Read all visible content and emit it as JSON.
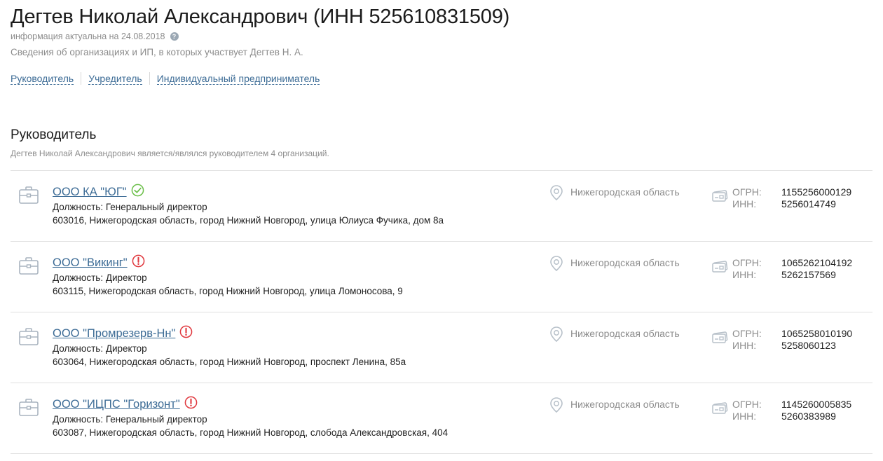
{
  "header": {
    "title": "Дегтев Николай Александрович (ИНН 525610831509)",
    "info_date": "информация актуальна на 24.08.2018",
    "help_glyph": "?",
    "subtitle": "Сведения об организациях и ИП, в которых участвует Дегтев Н. А."
  },
  "role_links": [
    {
      "label": "Руководитель"
    },
    {
      "label": "Учредитель"
    },
    {
      "label": "Индивидуальный предприниматель"
    }
  ],
  "section": {
    "title": "Руководитель",
    "description": "Дегтев Николай Александрович является/являлся руководителем 4 организаций."
  },
  "labels": {
    "ogrn": "ОГРН:",
    "inn": "ИНН:"
  },
  "organizations": [
    {
      "name": "ООО КА \"ЮГ\"",
      "status": "verified",
      "position": "Должность: Генеральный директор",
      "address": "603016, Нижегородская область, город Нижний Новгород, улица Юлиуса Фучика, дом 8а",
      "region": "Нижегородская область",
      "ogrn": "1155256000129",
      "inn": "5256014749"
    },
    {
      "name": "ООО \"Викинг\"",
      "status": "warning",
      "position": "Должность: Директор",
      "address": "603115, Нижегородская область, город Нижний Новгород, улица Ломоносова, 9",
      "region": "Нижегородская область",
      "ogrn": "1065262104192",
      "inn": "5262157569"
    },
    {
      "name": "ООО \"Промрезерв-Нн\"",
      "status": "warning",
      "position": "Должность: Директор",
      "address": "603064, Нижегородская область, город Нижний Новгород, проспект Ленина, 85а",
      "region": "Нижегородская область",
      "ogrn": "1065258010190",
      "inn": "5258060123"
    },
    {
      "name": "ООО \"ИЦПС \"Горизонт\"",
      "status": "warning",
      "position": "Должность: Генеральный директор",
      "address": "603087, Нижегородская область, город Нижний Новгород, слобода Александровская, 404",
      "region": "Нижегородская область",
      "ogrn": "1145260005835",
      "inn": "5260383989"
    }
  ],
  "colors": {
    "link": "#3d6c96",
    "verified": "#6cbf4a",
    "warning": "#e0383e",
    "muted": "#8c8c8c",
    "icon": "#a9b4bf"
  },
  "icons": {
    "org": "briefcase-icon",
    "region": "map-pin-icon",
    "requisites": "id-card-icon",
    "verified": "check-circle-icon",
    "warning": "exclamation-circle-icon"
  }
}
